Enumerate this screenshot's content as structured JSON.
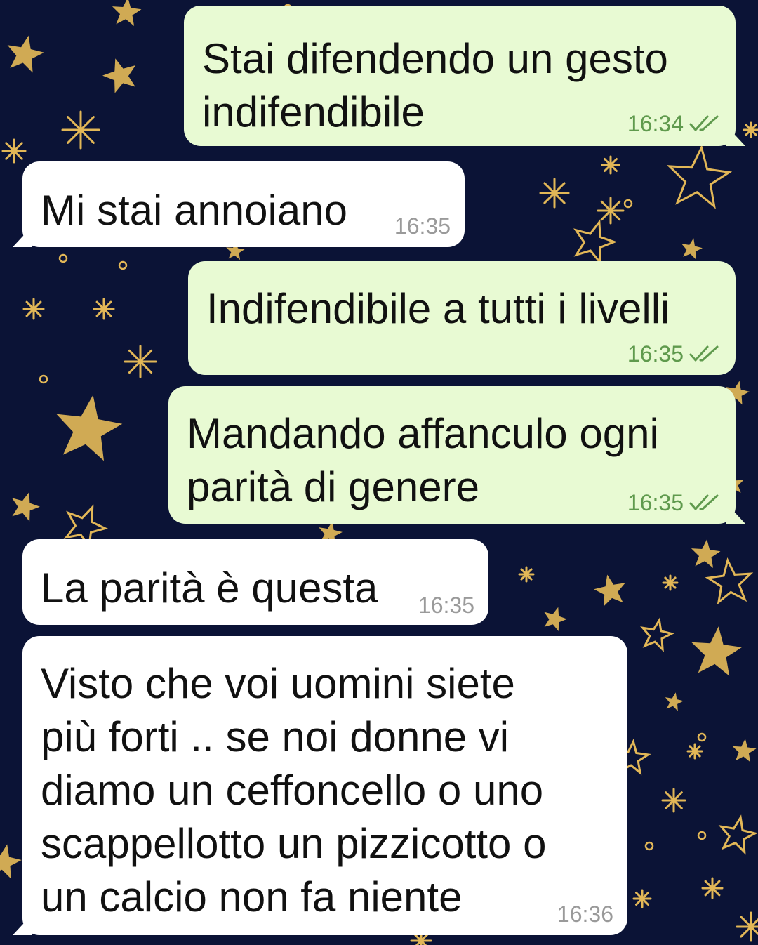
{
  "theme": {
    "wallpaper_bg": "#0b1336",
    "star_color": "#e2b757",
    "outgoing_bubble": "#e8fad3",
    "incoming_bubble": "#ffffff",
    "outgoing_time_color": "#5f9a4d",
    "incoming_time_color": "#9a9a9a",
    "read_tick_icon": "double-check-icon"
  },
  "messages": [
    {
      "direction": "outgoing",
      "text": "Stai difendendo un gesto\nindifendibile",
      "time": "16:34",
      "status": "read"
    },
    {
      "direction": "incoming",
      "text": "Mi stai annoiano",
      "time": "16:35"
    },
    {
      "direction": "outgoing",
      "text": "Indifendibile a tutti i livelli",
      "time": "16:35",
      "status": "read"
    },
    {
      "direction": "outgoing",
      "text": "Mandando affanculo ogni\nparità di genere",
      "time": "16:35",
      "status": "read"
    },
    {
      "direction": "incoming",
      "text": "La parità è questa",
      "time": "16:35"
    },
    {
      "direction": "incoming",
      "text": "Visto che voi uomini siete\npiù forti .. se noi donne vi\ndiamo un ceffoncello o uno\nscappellotto un pizzicotto o\nun calcio non fa niente",
      "time": "16:36"
    }
  ]
}
